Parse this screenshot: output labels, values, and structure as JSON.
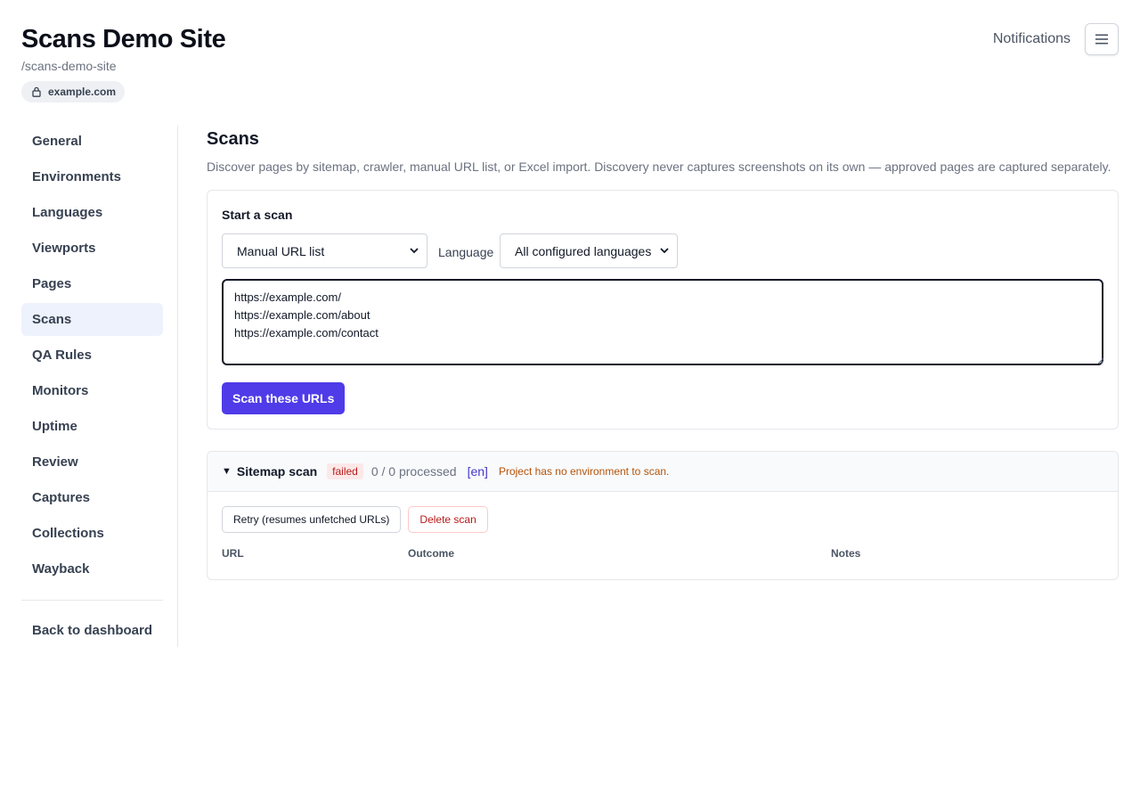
{
  "header": {
    "title": "Scans Demo Site",
    "slug": "/scans-demo-site",
    "domain": "example.com"
  },
  "topbar": {
    "notifications_label": "Notifications",
    "menu_icon": "hamburger-menu-icon"
  },
  "sidebar": {
    "items": [
      {
        "label": "General",
        "active": false
      },
      {
        "label": "Environments",
        "active": false
      },
      {
        "label": "Languages",
        "active": false
      },
      {
        "label": "Viewports",
        "active": false
      },
      {
        "label": "Pages",
        "active": false
      },
      {
        "label": "Scans",
        "active": true
      },
      {
        "label": "QA Rules",
        "active": false
      },
      {
        "label": "Monitors",
        "active": false
      },
      {
        "label": "Uptime",
        "active": false
      },
      {
        "label": "Review",
        "active": false
      },
      {
        "label": "Captures",
        "active": false
      },
      {
        "label": "Collections",
        "active": false
      },
      {
        "label": "Wayback",
        "active": false
      }
    ],
    "back_label": "Back to dashboard"
  },
  "main": {
    "title": "Scans",
    "description": "Discover pages by sitemap, crawler, manual URL list, or Excel import. Discovery never captures screenshots on its own — approved pages are captured separately.",
    "start_scan": {
      "title": "Start a scan",
      "mode_value": "Manual URL list",
      "language_label": "Language",
      "language_value": "All configured languages",
      "urls_value": "https://example.com/\nhttps://example.com/about\nhttps://example.com/contact",
      "submit_label": "Scan these URLs"
    },
    "scan": {
      "type": "Sitemap scan",
      "status": "failed",
      "progress": "0 / 0 processed",
      "language": "[en]",
      "error": "Project has no environment to scan.",
      "retry_label": "Retry (resumes unfetched URLs)",
      "delete_label": "Delete scan",
      "columns": [
        "URL",
        "Outcome",
        "Notes"
      ]
    }
  },
  "colors": {
    "primary": "#4f3be8",
    "active_nav_bg": "#eef2fc",
    "danger": "#b91c1c",
    "warning_text": "#b45309"
  }
}
